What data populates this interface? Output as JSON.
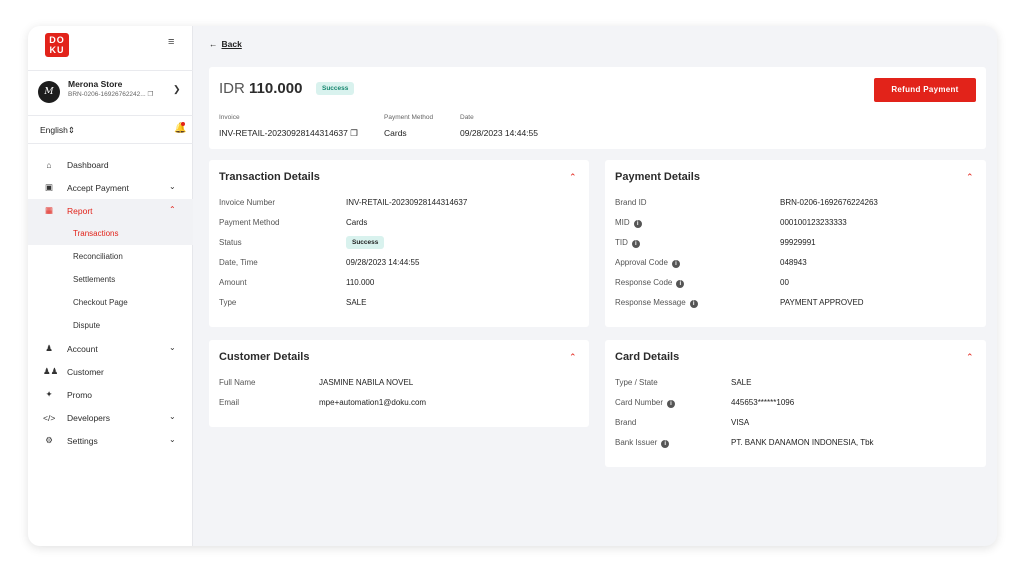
{
  "brand": {
    "logo_text": "DOKU",
    "accent": "#e2231a"
  },
  "store": {
    "avatar_letter": "M",
    "name": "Merona Store",
    "id": "BRN-0206-16926762242..."
  },
  "language": {
    "selected": "English"
  },
  "nav": [
    {
      "label": "Dashboard",
      "icon": "home-icon"
    },
    {
      "label": "Accept Payment",
      "icon": "payment-icon"
    },
    {
      "label": "Report",
      "icon": "report-icon"
    },
    {
      "label": "Account",
      "icon": "account-icon"
    },
    {
      "label": "Customer",
      "icon": "customer-icon"
    },
    {
      "label": "Promo",
      "icon": "promo-icon"
    },
    {
      "label": "Developers",
      "icon": "code-icon"
    },
    {
      "label": "Settings",
      "icon": "settings-icon"
    }
  ],
  "subnav": [
    "Transactions",
    "Reconciliation",
    "Settlements",
    "Checkout Page",
    "Dispute"
  ],
  "back_label": "Back",
  "summary": {
    "currency": "IDR",
    "amount": "110.000",
    "status": "Success",
    "refund_label": "Refund Payment",
    "invoice_label": "Invoice",
    "invoice_value": "INV-RETAIL-20230928144314637",
    "method_label": "Payment Method",
    "method_value": "Cards",
    "date_label": "Date",
    "date_value": "09/28/2023 14:44:55"
  },
  "transaction": {
    "title": "Transaction Details",
    "rows": [
      {
        "k": "Invoice Number",
        "v": "INV-RETAIL-20230928144314637"
      },
      {
        "k": "Payment Method",
        "v": "Cards"
      },
      {
        "k": "Status",
        "v": "Success"
      },
      {
        "k": "Date, Time",
        "v": "09/28/2023 14:44:55"
      },
      {
        "k": "Amount",
        "v": "110.000"
      },
      {
        "k": "Type",
        "v": "SALE"
      }
    ]
  },
  "payment": {
    "title": "Payment Details",
    "rows": [
      {
        "k": "Brand ID",
        "v": "BRN-0206-1692676224263"
      },
      {
        "k": "MID",
        "v": "000100123233333"
      },
      {
        "k": "TID",
        "v": "99929991"
      },
      {
        "k": "Approval Code",
        "v": "048943"
      },
      {
        "k": "Response Code",
        "v": "00"
      },
      {
        "k": "Response Message",
        "v": "PAYMENT APPROVED"
      }
    ]
  },
  "customer": {
    "title": "Customer Details",
    "rows": [
      {
        "k": "Full Name",
        "v": "JASMINE NABILA NOVEL"
      },
      {
        "k": "Email",
        "v": "mpe+automation1@doku.com"
      }
    ]
  },
  "card": {
    "title": "Card Details",
    "rows": [
      {
        "k": "Type / State",
        "v": "SALE"
      },
      {
        "k": "Card Number",
        "v": "445653******1096"
      },
      {
        "k": "Brand",
        "v": "VISA"
      },
      {
        "k": "Bank Issuer",
        "v": "PT. BANK DANAMON INDONESIA, Tbk"
      }
    ]
  }
}
